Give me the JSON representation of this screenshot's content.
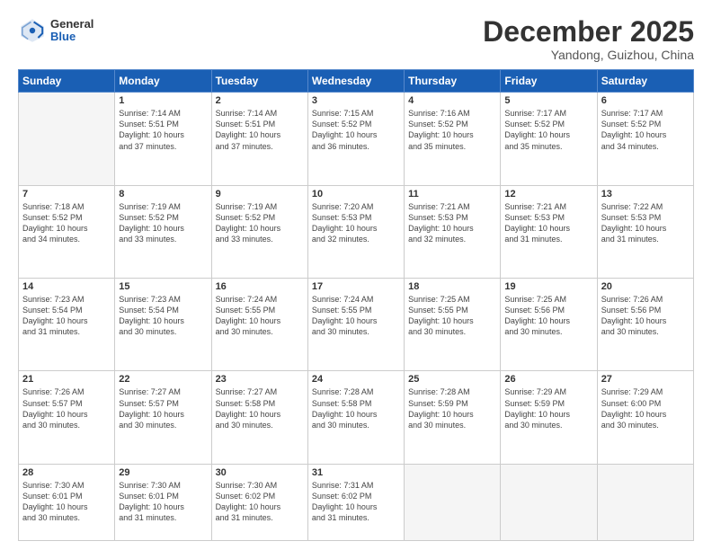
{
  "header": {
    "logo_general": "General",
    "logo_blue": "Blue",
    "month": "December 2025",
    "location": "Yandong, Guizhou, China"
  },
  "weekdays": [
    "Sunday",
    "Monday",
    "Tuesday",
    "Wednesday",
    "Thursday",
    "Friday",
    "Saturday"
  ],
  "weeks": [
    [
      {
        "day": "",
        "info": ""
      },
      {
        "day": "1",
        "info": "Sunrise: 7:14 AM\nSunset: 5:51 PM\nDaylight: 10 hours\nand 37 minutes."
      },
      {
        "day": "2",
        "info": "Sunrise: 7:14 AM\nSunset: 5:51 PM\nDaylight: 10 hours\nand 37 minutes."
      },
      {
        "day": "3",
        "info": "Sunrise: 7:15 AM\nSunset: 5:52 PM\nDaylight: 10 hours\nand 36 minutes."
      },
      {
        "day": "4",
        "info": "Sunrise: 7:16 AM\nSunset: 5:52 PM\nDaylight: 10 hours\nand 35 minutes."
      },
      {
        "day": "5",
        "info": "Sunrise: 7:17 AM\nSunset: 5:52 PM\nDaylight: 10 hours\nand 35 minutes."
      },
      {
        "day": "6",
        "info": "Sunrise: 7:17 AM\nSunset: 5:52 PM\nDaylight: 10 hours\nand 34 minutes."
      }
    ],
    [
      {
        "day": "7",
        "info": "Sunrise: 7:18 AM\nSunset: 5:52 PM\nDaylight: 10 hours\nand 34 minutes."
      },
      {
        "day": "8",
        "info": "Sunrise: 7:19 AM\nSunset: 5:52 PM\nDaylight: 10 hours\nand 33 minutes."
      },
      {
        "day": "9",
        "info": "Sunrise: 7:19 AM\nSunset: 5:52 PM\nDaylight: 10 hours\nand 33 minutes."
      },
      {
        "day": "10",
        "info": "Sunrise: 7:20 AM\nSunset: 5:53 PM\nDaylight: 10 hours\nand 32 minutes."
      },
      {
        "day": "11",
        "info": "Sunrise: 7:21 AM\nSunset: 5:53 PM\nDaylight: 10 hours\nand 32 minutes."
      },
      {
        "day": "12",
        "info": "Sunrise: 7:21 AM\nSunset: 5:53 PM\nDaylight: 10 hours\nand 31 minutes."
      },
      {
        "day": "13",
        "info": "Sunrise: 7:22 AM\nSunset: 5:53 PM\nDaylight: 10 hours\nand 31 minutes."
      }
    ],
    [
      {
        "day": "14",
        "info": "Sunrise: 7:23 AM\nSunset: 5:54 PM\nDaylight: 10 hours\nand 31 minutes."
      },
      {
        "day": "15",
        "info": "Sunrise: 7:23 AM\nSunset: 5:54 PM\nDaylight: 10 hours\nand 30 minutes."
      },
      {
        "day": "16",
        "info": "Sunrise: 7:24 AM\nSunset: 5:55 PM\nDaylight: 10 hours\nand 30 minutes."
      },
      {
        "day": "17",
        "info": "Sunrise: 7:24 AM\nSunset: 5:55 PM\nDaylight: 10 hours\nand 30 minutes."
      },
      {
        "day": "18",
        "info": "Sunrise: 7:25 AM\nSunset: 5:55 PM\nDaylight: 10 hours\nand 30 minutes."
      },
      {
        "day": "19",
        "info": "Sunrise: 7:25 AM\nSunset: 5:56 PM\nDaylight: 10 hours\nand 30 minutes."
      },
      {
        "day": "20",
        "info": "Sunrise: 7:26 AM\nSunset: 5:56 PM\nDaylight: 10 hours\nand 30 minutes."
      }
    ],
    [
      {
        "day": "21",
        "info": "Sunrise: 7:26 AM\nSunset: 5:57 PM\nDaylight: 10 hours\nand 30 minutes."
      },
      {
        "day": "22",
        "info": "Sunrise: 7:27 AM\nSunset: 5:57 PM\nDaylight: 10 hours\nand 30 minutes."
      },
      {
        "day": "23",
        "info": "Sunrise: 7:27 AM\nSunset: 5:58 PM\nDaylight: 10 hours\nand 30 minutes."
      },
      {
        "day": "24",
        "info": "Sunrise: 7:28 AM\nSunset: 5:58 PM\nDaylight: 10 hours\nand 30 minutes."
      },
      {
        "day": "25",
        "info": "Sunrise: 7:28 AM\nSunset: 5:59 PM\nDaylight: 10 hours\nand 30 minutes."
      },
      {
        "day": "26",
        "info": "Sunrise: 7:29 AM\nSunset: 5:59 PM\nDaylight: 10 hours\nand 30 minutes."
      },
      {
        "day": "27",
        "info": "Sunrise: 7:29 AM\nSunset: 6:00 PM\nDaylight: 10 hours\nand 30 minutes."
      }
    ],
    [
      {
        "day": "28",
        "info": "Sunrise: 7:30 AM\nSunset: 6:01 PM\nDaylight: 10 hours\nand 30 minutes."
      },
      {
        "day": "29",
        "info": "Sunrise: 7:30 AM\nSunset: 6:01 PM\nDaylight: 10 hours\nand 31 minutes."
      },
      {
        "day": "30",
        "info": "Sunrise: 7:30 AM\nSunset: 6:02 PM\nDaylight: 10 hours\nand 31 minutes."
      },
      {
        "day": "31",
        "info": "Sunrise: 7:31 AM\nSunset: 6:02 PM\nDaylight: 10 hours\nand 31 minutes."
      },
      {
        "day": "",
        "info": ""
      },
      {
        "day": "",
        "info": ""
      },
      {
        "day": "",
        "info": ""
      }
    ]
  ]
}
